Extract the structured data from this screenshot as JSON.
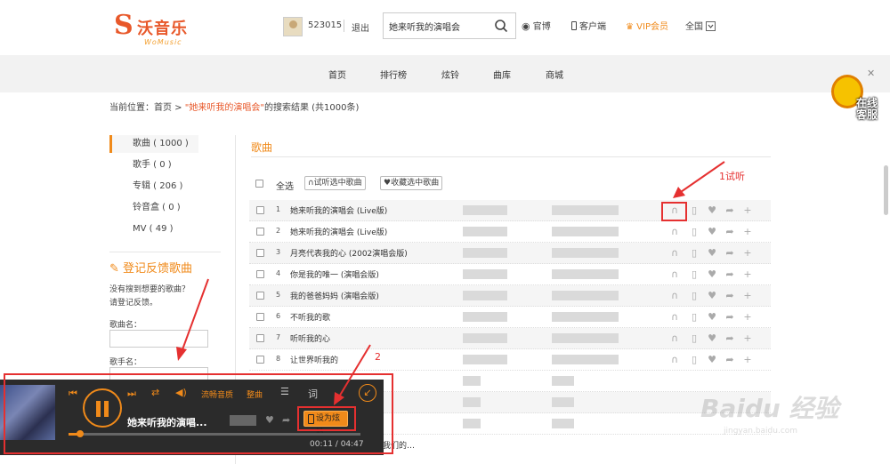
{
  "header": {
    "logo_text": "沃音乐",
    "logo_sub": "WoMusic",
    "user_id": "523015",
    "logout": "退出",
    "search_value": "她来听我的演唱会",
    "weibo": "官博",
    "client": "客户端",
    "vip": "VIP会员",
    "region": "全国"
  },
  "nav": {
    "items": [
      "首页",
      "排行榜",
      "炫铃",
      "曲库",
      "商城"
    ]
  },
  "breadcrumb": {
    "prefix": "当前位置：首页 > ",
    "query": "\"她来听我的演唱会\"",
    "suffix": "的搜索结果 (共1000条)"
  },
  "sidebar": {
    "items": [
      {
        "label": "歌曲 ( 1000 )",
        "active": true
      },
      {
        "label": "歌手 ( 0 )"
      },
      {
        "label": "专辑 ( 206 )"
      },
      {
        "label": "铃音盒 ( 0 )"
      },
      {
        "label": "MV ( 49 )"
      }
    ]
  },
  "feedback": {
    "title": "登记反馈歌曲",
    "desc1": "没有搜到想要的歌曲？",
    "desc2": "请登记反馈。",
    "song_label": "歌曲名：",
    "singer_label": "歌手名："
  },
  "results": {
    "section_title": "歌曲",
    "select_all": "全选",
    "listen_selected": "试听选中歌曲",
    "collect_selected": "收藏选中歌曲",
    "rows": [
      {
        "num": "1",
        "title": "她来听我的演唱会 (Live版)"
      },
      {
        "num": "2",
        "title": "她来听我的演唱会 (Live版)"
      },
      {
        "num": "3",
        "title": "月亮代表我的心 (2002演唱会版)"
      },
      {
        "num": "4",
        "title": "你是我的唯一 (演唱会版)"
      },
      {
        "num": "5",
        "title": "我的爸爸妈妈 (演唱会版)"
      },
      {
        "num": "6",
        "title": "不听我的歌"
      },
      {
        "num": "7",
        "title": "听听我的心"
      },
      {
        "num": "8",
        "title": "让世界听我的"
      }
    ],
    "partial_row": "我们的…"
  },
  "player": {
    "quality": "流畅音质",
    "track_info": "整曲",
    "lyrics": "词",
    "title": "她来听我的演唱...",
    "set_ringtone": "设为炫铃",
    "time": "00:11 / 04:47",
    "progress_fraction": 0.04
  },
  "annotations": {
    "label1": "1试听",
    "label2": "2"
  },
  "service": {
    "line1": "在线",
    "line2": "客服"
  },
  "watermark": {
    "brand": "Baidu 经验",
    "url": "jingyan.baidu.com"
  },
  "colors": {
    "accent": "#f08a1a",
    "brand": "#e8582a",
    "annotation": "#e53030"
  }
}
